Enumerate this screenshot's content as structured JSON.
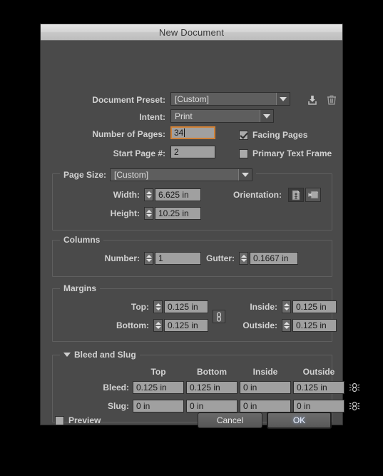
{
  "window": {
    "title": "New Document"
  },
  "preset": {
    "label": "Document Preset:",
    "value": "[Custom]",
    "save_icon": "save-preset-icon",
    "delete_icon": "trash-icon"
  },
  "intent": {
    "label": "Intent:",
    "value": "Print"
  },
  "pages": {
    "number_label": "Number of Pages:",
    "number_value": "34",
    "start_label": "Start Page #:",
    "start_value": "2",
    "facing_label": "Facing Pages",
    "facing_checked": true,
    "primary_label": "Primary Text Frame",
    "primary_checked": false
  },
  "page_size": {
    "title": "Page Size:",
    "value": "[Custom]",
    "width_label": "Width:",
    "width_value": "6.625 in",
    "height_label": "Height:",
    "height_value": "10.25 in",
    "orientation_label": "Orientation:",
    "portrait_icon": "portrait-orientation-icon",
    "landscape_icon": "landscape-orientation-icon",
    "portrait_selected": true
  },
  "columns": {
    "title": "Columns",
    "number_label": "Number:",
    "number_value": "1",
    "gutter_label": "Gutter:",
    "gutter_value": "0.1667 in"
  },
  "margins": {
    "title": "Margins",
    "top_label": "Top:",
    "top_value": "0.125 in",
    "bottom_label": "Bottom:",
    "bottom_value": "0.125 in",
    "inside_label": "Inside:",
    "inside_value": "0.125 in",
    "outside_label": "Outside:",
    "outside_value": "0.125 in",
    "link_icon": "chain-link-icon"
  },
  "bleed_slug": {
    "title": "Bleed and Slug",
    "expanded": true,
    "columns": [
      "Top",
      "Bottom",
      "Inside",
      "Outside"
    ],
    "rows": [
      {
        "label": "Bleed:",
        "values": [
          "0.125 in",
          "0.125 in",
          "0 in",
          "0.125 in"
        ],
        "link_icon": "chain-link-icon"
      },
      {
        "label": "Slug:",
        "values": [
          "0 in",
          "0 in",
          "0 in",
          "0 in"
        ],
        "link_icon": "chain-link-icon"
      }
    ]
  },
  "footer": {
    "preview_label": "Preview",
    "preview_checked": false,
    "cancel_label": "Cancel",
    "ok_label": "OK"
  },
  "colors": {
    "dialog_bg": "#4a4a4a",
    "field_bg": "#a0a0a0",
    "focus_border": "#cf8137",
    "text": "#d2d2d2"
  }
}
